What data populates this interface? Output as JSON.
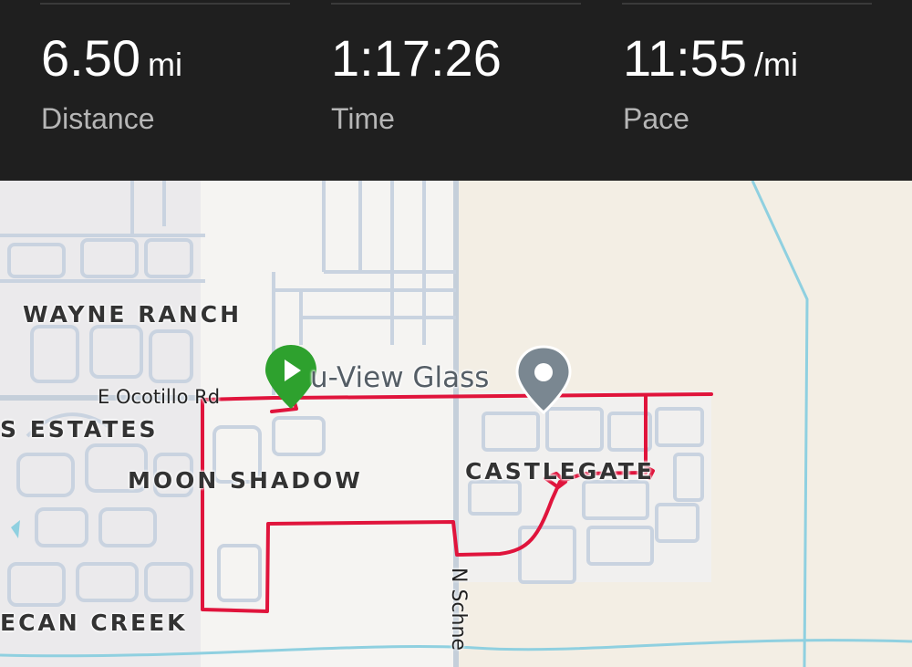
{
  "stats": {
    "distance": {
      "value": "6.50",
      "unit": "mi",
      "label": "Distance"
    },
    "time": {
      "value": "1:17:26",
      "unit": "",
      "label": "Time"
    },
    "pace": {
      "value": "11:55",
      "unit": "/mi",
      "label": "Pace"
    }
  },
  "map": {
    "areas": {
      "wayne_ranch": "WAYNE RANCH",
      "estates": "S ESTATES",
      "moon_shadow": "MOON SHADOW",
      "castlegate": "CASTLEGATE",
      "pecan_creek": "ECAN CREEK"
    },
    "roads": {
      "ocotillo": "E Ocotillo Rd",
      "schnepf": "N Schne"
    },
    "poi": {
      "name": "u-View Glass",
      "icon": "place-pin-icon"
    },
    "route": {
      "color": "#e0143c",
      "start_icon": "play-start-icon",
      "start_color": "#2ea12e"
    },
    "colors": {
      "land": "#f3eee4",
      "road": "#c9d3e0",
      "water": "#8fd0e0"
    }
  }
}
